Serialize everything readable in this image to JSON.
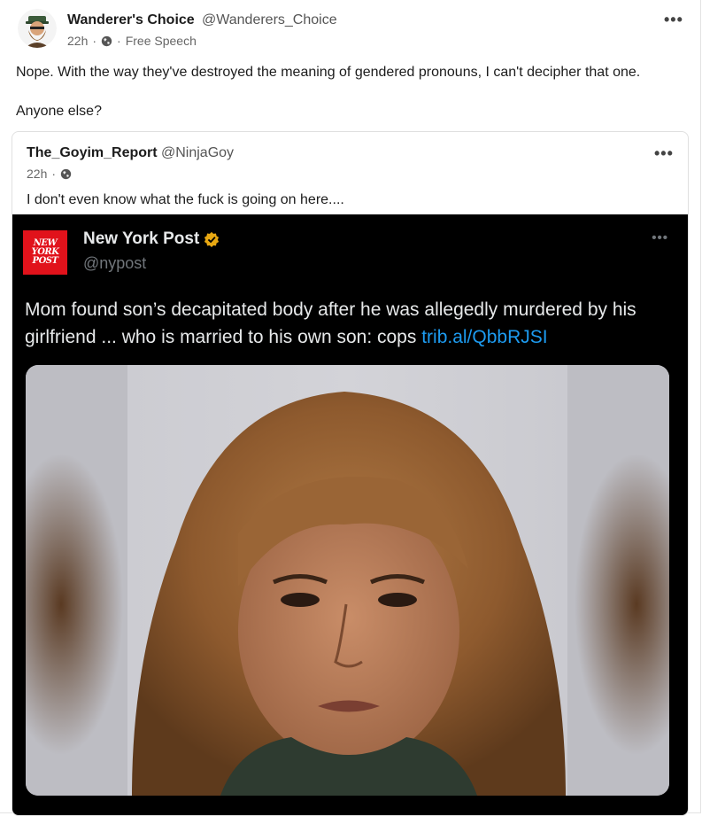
{
  "post": {
    "author": "Wanderer's Choice",
    "handle": "@Wanderers_Choice",
    "time": "22h",
    "dot": "·",
    "community": "Free Speech",
    "text_line1": "Nope. With the way they've destroyed the meaning of gendered pronouns, I can't decipher that one.",
    "text_line2": "Anyone else?",
    "more_label": "•••"
  },
  "quote": {
    "author": "The_Goyim_Report",
    "handle": "@NinjaGoy",
    "time": "22h",
    "dot": "·",
    "text": "I don't even know what the fuck is going on here....",
    "more_label": "•••"
  },
  "embedded_tweet": {
    "logo_lines": [
      "NEW",
      "YORK",
      "POST"
    ],
    "name": "New York Post",
    "handle": "@nypost",
    "headline_text": "Mom found son’s decapitated body after he was allegedly murdered by his girlfriend ... who is married to his own son: cops ",
    "headline_link": "trib.al/QbbRJSI",
    "more_label": "•••"
  },
  "colors": {
    "link": "#1d9bf0",
    "nyp_red": "#e1121b",
    "verified_gold": "#e8a812"
  },
  "icons": [
    "avatar-image",
    "globe-icon",
    "more-icon",
    "verified-badge-icon",
    "nypost-logo"
  ]
}
